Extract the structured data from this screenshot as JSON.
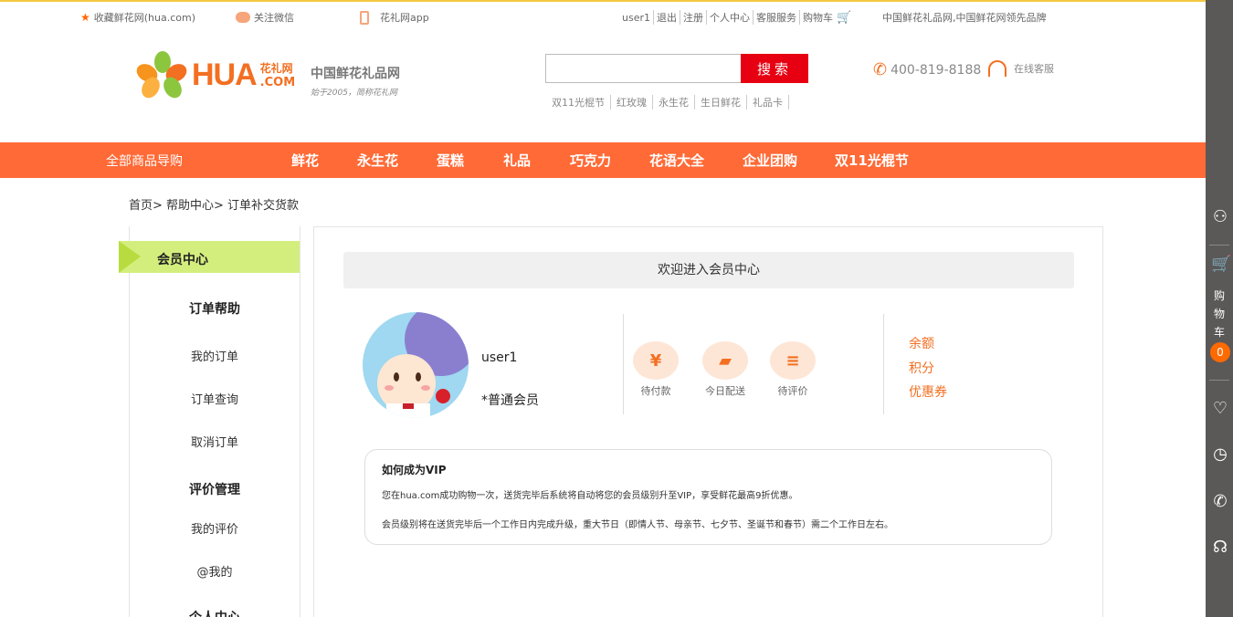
{
  "topbar": {
    "bookmark": "收藏鲜花网(hua.com)",
    "wechat": "关注微信",
    "app": "花礼网app",
    "links": [
      "user1",
      "退出",
      "注册",
      "个人中心",
      "客服服务",
      "购物车"
    ],
    "slogan": "中国鲜花礼品网,中国鲜花网领先品牌"
  },
  "header": {
    "logo_text": "HUA",
    "logo_cn": "花礼网",
    "logo_com": ".COM",
    "tagline1": "中国鲜花礼品网",
    "tagline2": "始于2005，简称花礼网",
    "search_button": "搜索",
    "search_placeholder": "",
    "hotwords": [
      "双11光棍节",
      "红玫瑰",
      "永生花",
      "生日鲜花",
      "礼品卡"
    ],
    "hotline": "400-819-8188",
    "kefu": "在线客服"
  },
  "nav": {
    "all": "全部商品导购",
    "items": [
      "鲜花",
      "永生花",
      "蛋糕",
      "礼品",
      "巧克力",
      "花语大全",
      "企业团购",
      "双11光棍节"
    ]
  },
  "breadcrumb": "首页> 帮助中心> 订单补交货款",
  "sidebar": {
    "head": "会员中心",
    "sec1": "订单帮助",
    "sec1_links": [
      "我的订单",
      "订单查询",
      "取消订单"
    ],
    "sec2": "评价管理",
    "sec2_links": [
      "我的评价",
      "@我的"
    ],
    "sec3": "个人中心"
  },
  "main": {
    "welcome": "欢迎进入会员中心",
    "username": "user1",
    "level": "*普通会员",
    "orders": [
      "待付款",
      "今日配送",
      "待评价"
    ],
    "account": [
      "余额",
      "积分",
      "优惠券"
    ],
    "vip_title": "如何成为VIP",
    "vip_p1": "您在hua.com成功购物一次，送货完毕后系统将自动将您的会员级别升至VIP，享受鲜花最高9折优惠。",
    "vip_p2": "会员级别将在送货完毕后一个工作日内完成升级，重大节日（即情人节、母亲节、七夕节、圣诞节和春节）需二个工作日左右。"
  },
  "rightbar": {
    "cart_label": "购物车",
    "cart_count": "0"
  },
  "colors": {
    "nav": "#ff6a36",
    "brand": "#f36f21",
    "search_button": "#e60012",
    "sidebar_head": "#d4ee7e",
    "toolbar": "#5b5858"
  }
}
